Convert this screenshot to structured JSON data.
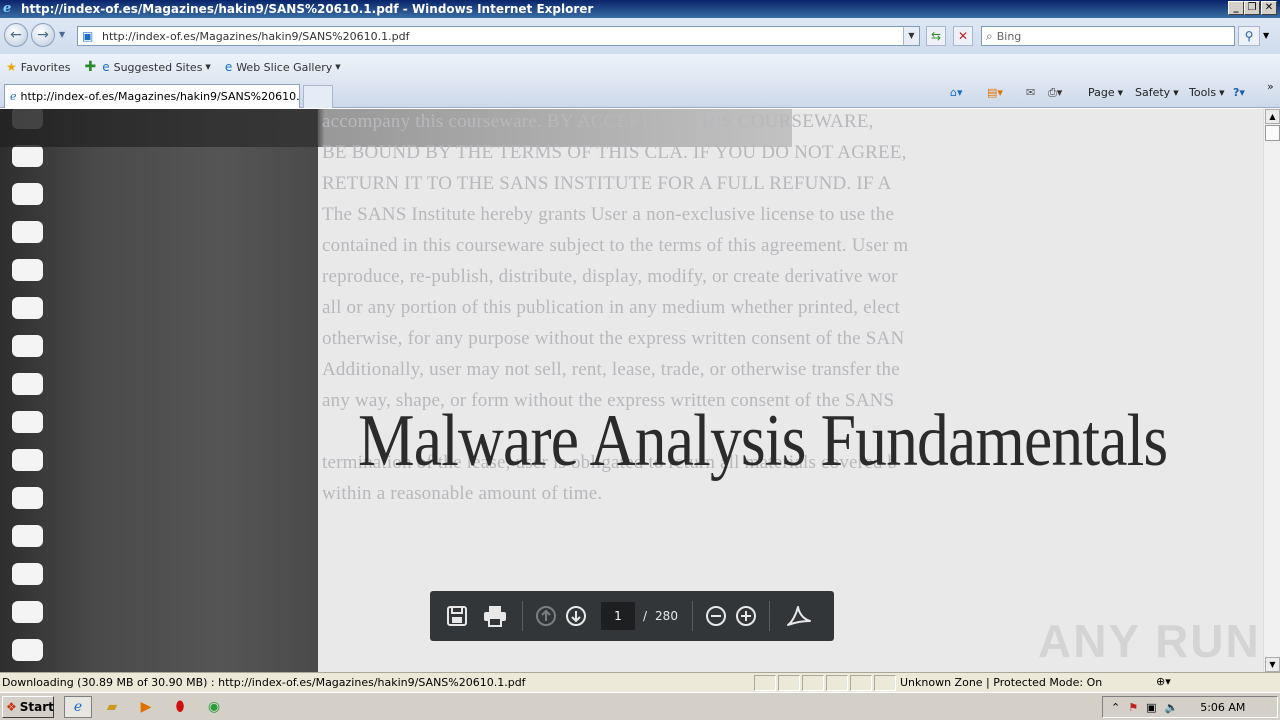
{
  "window": {
    "title": "http://index-of.es/Magazines/hakin9/SANS%20610.1.pdf - Windows Internet Explorer",
    "minimize": "_",
    "restore": "❐",
    "close": "✕"
  },
  "address": {
    "url": "http://index-of.es/Magazines/hakin9/SANS%20610.1.pdf",
    "search_placeholder": "Bing"
  },
  "favorites": {
    "favorites_label": "Favorites",
    "suggested_sites": "Suggested Sites",
    "web_slice_gallery": "Web Slice Gallery"
  },
  "tabs": {
    "active_tab_title": "http://index-of.es/Magazines/hakin9/SANS%20610.1..."
  },
  "command_bar": {
    "page": "Page",
    "safety": "Safety",
    "tools": "Tools"
  },
  "pdf": {
    "background_lines": [
      "accompany this courseware. BY ACCEPTING THIS COURSEWARE,",
      "BE BOUND BY THE TERMS OF THIS CLA. IF YOU DO NOT AGREE,",
      "RETURN IT TO THE SANS INSTITUTE FOR A FULL REFUND. IF A",
      "The SANS Institute hereby grants User a non-exclusive license to use the",
      "contained in this courseware subject to the terms of this agreement. User m",
      "reproduce, re-publish, distribute, display, modify, or create derivative wor",
      "all or any portion of this publication in any medium whether printed, elect",
      "otherwise, for any purpose without the express written consent of the SAN",
      "Additionally, user may not sell, rent, lease, trade, or otherwise transfer the",
      "any way, shape, or form without the express written consent of the SANS",
      "",
      "termination of the lease, user is obligated to return all materials covered b",
      "within a reasonable amount of time."
    ],
    "title": "Malware Analysis Fundamentals",
    "current_page": "1",
    "page_separator": "/",
    "total_pages": "280",
    "watermark": "ANY RUN"
  },
  "status": {
    "download_text": "Downloading (30.89 MB of 30.90 MB) : http://index-of.es/Magazines/hakin9/SANS%20610.1.pdf",
    "zone_text": "Unknown Zone | Protected Mode: On"
  },
  "taskbar": {
    "start_label": "Start",
    "clock": "5:06 AM"
  }
}
